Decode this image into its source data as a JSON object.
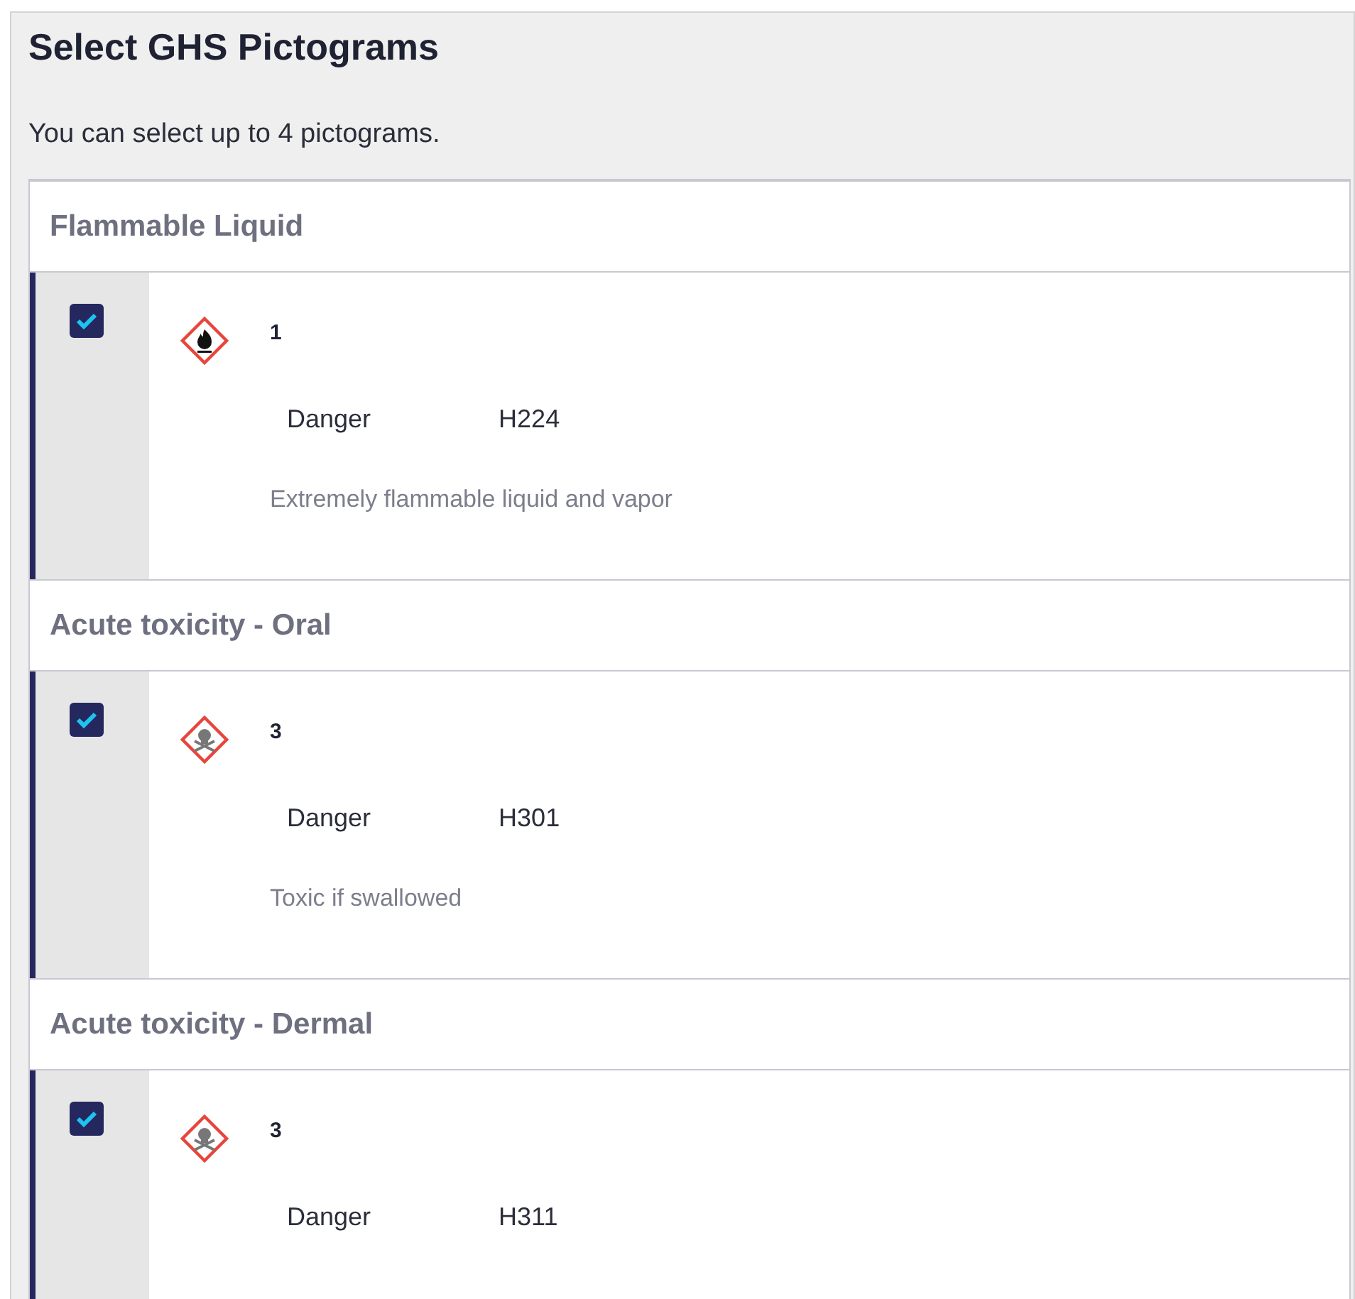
{
  "title": "Select GHS Pictograms",
  "subtitle": "You can select up to 4 pictograms.",
  "hazards": [
    {
      "heading": "Flammable Liquid",
      "checked": true,
      "kind": "flame",
      "category": "1",
      "signal_word": "Danger",
      "code": "H224",
      "description": "Extremely flammable liquid and vapor"
    },
    {
      "heading": "Acute toxicity - Oral",
      "checked": true,
      "kind": "skull",
      "category": "3",
      "signal_word": "Danger",
      "code": "H301",
      "description": "Toxic if swallowed"
    },
    {
      "heading": "Acute toxicity - Dermal",
      "checked": true,
      "kind": "skull",
      "category": "3",
      "signal_word": "Danger",
      "code": "H311"
    }
  ]
}
